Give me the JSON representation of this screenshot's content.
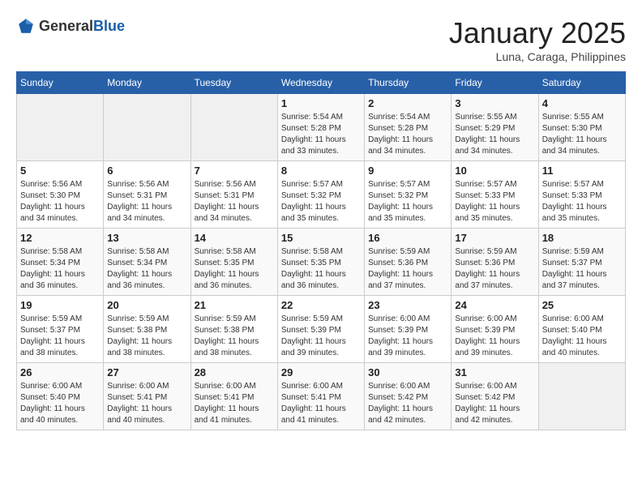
{
  "header": {
    "logo_general": "General",
    "logo_blue": "Blue",
    "month_title": "January 2025",
    "location": "Luna, Caraga, Philippines"
  },
  "weekdays": [
    "Sunday",
    "Monday",
    "Tuesday",
    "Wednesday",
    "Thursday",
    "Friday",
    "Saturday"
  ],
  "weeks": [
    [
      {
        "day": "",
        "sunrise": "",
        "sunset": "",
        "daylight": ""
      },
      {
        "day": "",
        "sunrise": "",
        "sunset": "",
        "daylight": ""
      },
      {
        "day": "",
        "sunrise": "",
        "sunset": "",
        "daylight": ""
      },
      {
        "day": "1",
        "sunrise": "Sunrise: 5:54 AM",
        "sunset": "Sunset: 5:28 PM",
        "daylight": "Daylight: 11 hours and 33 minutes."
      },
      {
        "day": "2",
        "sunrise": "Sunrise: 5:54 AM",
        "sunset": "Sunset: 5:28 PM",
        "daylight": "Daylight: 11 hours and 34 minutes."
      },
      {
        "day": "3",
        "sunrise": "Sunrise: 5:55 AM",
        "sunset": "Sunset: 5:29 PM",
        "daylight": "Daylight: 11 hours and 34 minutes."
      },
      {
        "day": "4",
        "sunrise": "Sunrise: 5:55 AM",
        "sunset": "Sunset: 5:30 PM",
        "daylight": "Daylight: 11 hours and 34 minutes."
      }
    ],
    [
      {
        "day": "5",
        "sunrise": "Sunrise: 5:56 AM",
        "sunset": "Sunset: 5:30 PM",
        "daylight": "Daylight: 11 hours and 34 minutes."
      },
      {
        "day": "6",
        "sunrise": "Sunrise: 5:56 AM",
        "sunset": "Sunset: 5:31 PM",
        "daylight": "Daylight: 11 hours and 34 minutes."
      },
      {
        "day": "7",
        "sunrise": "Sunrise: 5:56 AM",
        "sunset": "Sunset: 5:31 PM",
        "daylight": "Daylight: 11 hours and 34 minutes."
      },
      {
        "day": "8",
        "sunrise": "Sunrise: 5:57 AM",
        "sunset": "Sunset: 5:32 PM",
        "daylight": "Daylight: 11 hours and 35 minutes."
      },
      {
        "day": "9",
        "sunrise": "Sunrise: 5:57 AM",
        "sunset": "Sunset: 5:32 PM",
        "daylight": "Daylight: 11 hours and 35 minutes."
      },
      {
        "day": "10",
        "sunrise": "Sunrise: 5:57 AM",
        "sunset": "Sunset: 5:33 PM",
        "daylight": "Daylight: 11 hours and 35 minutes."
      },
      {
        "day": "11",
        "sunrise": "Sunrise: 5:57 AM",
        "sunset": "Sunset: 5:33 PM",
        "daylight": "Daylight: 11 hours and 35 minutes."
      }
    ],
    [
      {
        "day": "12",
        "sunrise": "Sunrise: 5:58 AM",
        "sunset": "Sunset: 5:34 PM",
        "daylight": "Daylight: 11 hours and 36 minutes."
      },
      {
        "day": "13",
        "sunrise": "Sunrise: 5:58 AM",
        "sunset": "Sunset: 5:34 PM",
        "daylight": "Daylight: 11 hours and 36 minutes."
      },
      {
        "day": "14",
        "sunrise": "Sunrise: 5:58 AM",
        "sunset": "Sunset: 5:35 PM",
        "daylight": "Daylight: 11 hours and 36 minutes."
      },
      {
        "day": "15",
        "sunrise": "Sunrise: 5:58 AM",
        "sunset": "Sunset: 5:35 PM",
        "daylight": "Daylight: 11 hours and 36 minutes."
      },
      {
        "day": "16",
        "sunrise": "Sunrise: 5:59 AM",
        "sunset": "Sunset: 5:36 PM",
        "daylight": "Daylight: 11 hours and 37 minutes."
      },
      {
        "day": "17",
        "sunrise": "Sunrise: 5:59 AM",
        "sunset": "Sunset: 5:36 PM",
        "daylight": "Daylight: 11 hours and 37 minutes."
      },
      {
        "day": "18",
        "sunrise": "Sunrise: 5:59 AM",
        "sunset": "Sunset: 5:37 PM",
        "daylight": "Daylight: 11 hours and 37 minutes."
      }
    ],
    [
      {
        "day": "19",
        "sunrise": "Sunrise: 5:59 AM",
        "sunset": "Sunset: 5:37 PM",
        "daylight": "Daylight: 11 hours and 38 minutes."
      },
      {
        "day": "20",
        "sunrise": "Sunrise: 5:59 AM",
        "sunset": "Sunset: 5:38 PM",
        "daylight": "Daylight: 11 hours and 38 minutes."
      },
      {
        "day": "21",
        "sunrise": "Sunrise: 5:59 AM",
        "sunset": "Sunset: 5:38 PM",
        "daylight": "Daylight: 11 hours and 38 minutes."
      },
      {
        "day": "22",
        "sunrise": "Sunrise: 5:59 AM",
        "sunset": "Sunset: 5:39 PM",
        "daylight": "Daylight: 11 hours and 39 minutes."
      },
      {
        "day": "23",
        "sunrise": "Sunrise: 6:00 AM",
        "sunset": "Sunset: 5:39 PM",
        "daylight": "Daylight: 11 hours and 39 minutes."
      },
      {
        "day": "24",
        "sunrise": "Sunrise: 6:00 AM",
        "sunset": "Sunset: 5:39 PM",
        "daylight": "Daylight: 11 hours and 39 minutes."
      },
      {
        "day": "25",
        "sunrise": "Sunrise: 6:00 AM",
        "sunset": "Sunset: 5:40 PM",
        "daylight": "Daylight: 11 hours and 40 minutes."
      }
    ],
    [
      {
        "day": "26",
        "sunrise": "Sunrise: 6:00 AM",
        "sunset": "Sunset: 5:40 PM",
        "daylight": "Daylight: 11 hours and 40 minutes."
      },
      {
        "day": "27",
        "sunrise": "Sunrise: 6:00 AM",
        "sunset": "Sunset: 5:41 PM",
        "daylight": "Daylight: 11 hours and 40 minutes."
      },
      {
        "day": "28",
        "sunrise": "Sunrise: 6:00 AM",
        "sunset": "Sunset: 5:41 PM",
        "daylight": "Daylight: 11 hours and 41 minutes."
      },
      {
        "day": "29",
        "sunrise": "Sunrise: 6:00 AM",
        "sunset": "Sunset: 5:41 PM",
        "daylight": "Daylight: 11 hours and 41 minutes."
      },
      {
        "day": "30",
        "sunrise": "Sunrise: 6:00 AM",
        "sunset": "Sunset: 5:42 PM",
        "daylight": "Daylight: 11 hours and 42 minutes."
      },
      {
        "day": "31",
        "sunrise": "Sunrise: 6:00 AM",
        "sunset": "Sunset: 5:42 PM",
        "daylight": "Daylight: 11 hours and 42 minutes."
      },
      {
        "day": "",
        "sunrise": "",
        "sunset": "",
        "daylight": ""
      }
    ]
  ]
}
